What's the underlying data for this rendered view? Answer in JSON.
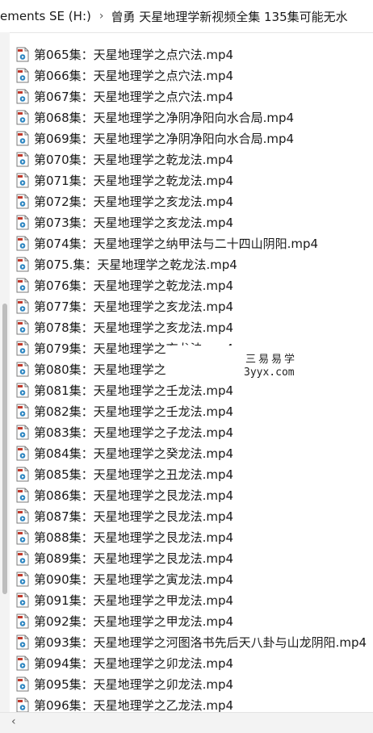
{
  "window": {
    "crumb_drive": "ements SE (H:)",
    "crumb_separator": "›",
    "crumb_folder": "曾勇 天星地理学新视频全集 135集可能无水"
  },
  "files": [
    {
      "name": "第065集：天星地理学之点穴法.mp4"
    },
    {
      "name": "第066集：天星地理学之点穴法.mp4"
    },
    {
      "name": "第067集：天星地理学之点穴法.mp4"
    },
    {
      "name": "第068集：天星地理学之净阴净阳向水合局.mp4"
    },
    {
      "name": "第069集：天星地理学之净阴净阳向水合局.mp4"
    },
    {
      "name": "第070集：天星地理学之乾龙法.mp4"
    },
    {
      "name": "第071集：天星地理学之乾龙法.mp4"
    },
    {
      "name": "第072集：天星地理学之亥龙法.mp4"
    },
    {
      "name": "第073集：天星地理学之亥龙法.mp4"
    },
    {
      "name": "第074集：天星地理学之纳甲法与二十四山阴阳.mp4"
    },
    {
      "name": "第075.集：天星地理学之乾龙法.mp4"
    },
    {
      "name": "第076集：天星地理学之乾龙法.mp4"
    },
    {
      "name": "第077集：天星地理学之亥龙法.mp4"
    },
    {
      "name": "第078集：天星地理学之亥龙法.mp4"
    },
    {
      "name": "第079集：天星地理学之亥龙法.mp4"
    },
    {
      "name": "第080集：天星地理学之"
    },
    {
      "name": "第081集：天星地理学之壬龙法.mp4"
    },
    {
      "name": "第082集：天星地理学之壬龙法.mp4"
    },
    {
      "name": "第083集：天星地理学之子龙法.mp4"
    },
    {
      "name": "第084集：天星地理学之癸龙法.mp4"
    },
    {
      "name": "第085集：天星地理学之丑龙法.mp4"
    },
    {
      "name": "第086集：天星地理学之艮龙法.mp4"
    },
    {
      "name": "第087集：天星地理学之艮龙法.mp4"
    },
    {
      "name": "第088集：天星地理学之艮龙法.mp4"
    },
    {
      "name": "第089集：天星地理学之艮龙法.mp4"
    },
    {
      "name": "第090集：天星地理学之寅龙法.mp4"
    },
    {
      "name": "第091集：天星地理学之甲龙法.mp4"
    },
    {
      "name": "第092集：天星地理学之甲龙法.mp4"
    },
    {
      "name": "第093集：天星地理学之河图洛书先后天八卦与山龙阴阳.mp4"
    },
    {
      "name": "第094集：天星地理学之卯龙法.mp4"
    },
    {
      "name": "第095集：天星地理学之卯龙法.mp4"
    },
    {
      "name": "第096集：天星地理学之乙龙法.mp4"
    }
  ],
  "watermark": {
    "line1": "三易易学",
    "line2": "3yyx.com"
  },
  "scrollbar": {
    "left_arrow": "‹"
  },
  "icons": {
    "file": "media-file-icon"
  },
  "colors": {
    "icon_badge": "#c0392b",
    "icon_accent": "#2e86c1"
  }
}
